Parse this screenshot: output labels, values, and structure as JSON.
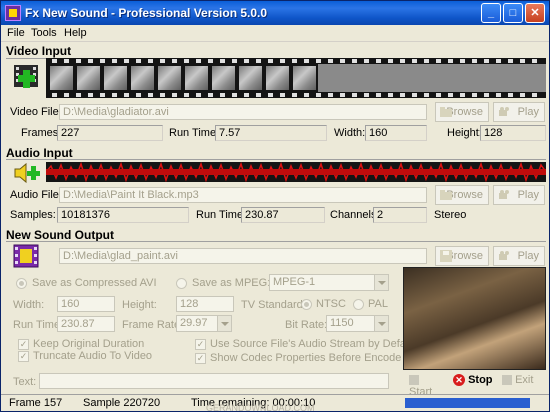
{
  "window": {
    "title": "Fx New Sound - Professional Version 5.0.0"
  },
  "menu": [
    "File",
    "Tools",
    "Help"
  ],
  "video_input": {
    "section_title": "Video Input",
    "file_label": "Video File:",
    "file_value": "D:\\Media\\gladiator.avi",
    "frames_label": "Frames:",
    "frames_value": "227",
    "runtime_label": "Run Time:",
    "runtime_value": "7.57",
    "width_label": "Width:",
    "width_value": "160",
    "height_label": "Height:",
    "height_value": "128",
    "browse_label": "Browse",
    "play_label": "Play"
  },
  "audio_input": {
    "section_title": "Audio Input",
    "file_label": "Audio File:",
    "file_value": "D:\\Media\\Paint It Black.mp3",
    "samples_label": "Samples:",
    "samples_value": "10181376",
    "runtime_label": "Run Time:",
    "runtime_value": "230.87",
    "channels_label": "Channels:",
    "channels_value": "2",
    "mode_value": "Stereo",
    "browse_label": "Browse",
    "play_label": "Play"
  },
  "output": {
    "section_title": "New Sound Output",
    "file_value": "D:\\Media\\glad_paint.avi",
    "browse_label": "Browse",
    "play_label": "Play",
    "save_avi_label": "Save as Compressed AVI",
    "save_mpeg_label": "Save as MPEG:",
    "mpeg_value": "MPEG-1",
    "width_label": "Width:",
    "width_value": "160",
    "height_label": "Height:",
    "height_value": "128",
    "tv_standard_label": "TV Standard:",
    "ntsc_label": "NTSC",
    "pal_label": "PAL",
    "runtime_label": "Run Time:",
    "runtime_value": "230.87",
    "framerate_label": "Frame Rate:",
    "framerate_value": "29.97",
    "bitrate_label": "Bit Rate:",
    "bitrate_value": "1150",
    "keep_duration_label": "Keep Original Duration",
    "truncate_label": "Truncate Audio To Video",
    "use_source_label": "Use Source File's Audio Stream by Default",
    "show_codec_label": "Show Codec Properties Before Encode",
    "text_label": "Text:",
    "text_value": ""
  },
  "actions": {
    "start": "Start",
    "stop": "Stop",
    "exit": "Exit"
  },
  "status": {
    "frame": "Frame 157",
    "sample": "Sample 220720",
    "time_remaining": "Time remaining: 00:00:10",
    "watermark": "GERANDOWNLOAD.COM"
  },
  "colors": {
    "title_bar": "#0a5fd8",
    "waveform": "#e01010",
    "progress": "#2a5fd0"
  }
}
